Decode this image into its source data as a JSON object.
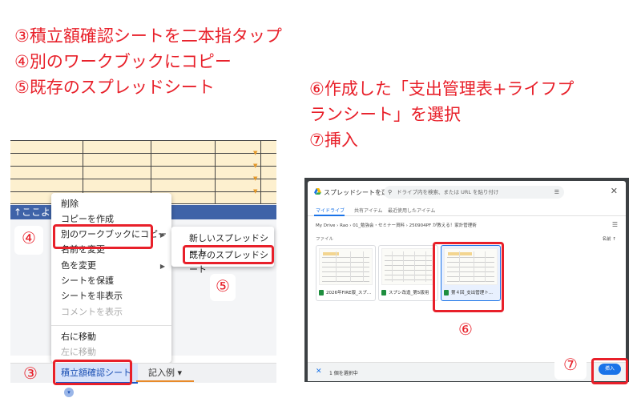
{
  "instructions": {
    "step3": "③積立額確認シートを二本指タップ",
    "step4": "④別のワークブックにコピー",
    "step5": "⑤既存のスプレッドシート",
    "step6_line1": "⑥作成した「支出管理表+ライフプ",
    "step6_line2": "ランシート」を選択",
    "step7": "⑦挿入"
  },
  "callouts": {
    "n3": "③",
    "n4": "④",
    "n5": "⑤",
    "n6": "⑥",
    "n7": "⑦"
  },
  "sheet": {
    "banner_text": "↑ここより上"
  },
  "context_menu": {
    "items": [
      {
        "label": "削除"
      },
      {
        "label": "コピーを作成"
      },
      {
        "label": "別のワークブックにコピー"
      },
      {
        "label": "名前を変更"
      },
      {
        "label": "色を変更"
      },
      {
        "label": "シートを保護"
      },
      {
        "label": "シートを非表示"
      },
      {
        "label": "コメントを表示"
      },
      {
        "label": "右に移動"
      },
      {
        "label": "左に移動"
      }
    ],
    "submenu_caret": "▶",
    "color_caret": "▶"
  },
  "submenu": {
    "items": [
      {
        "label": "新しいスプレッドシート"
      },
      {
        "label": "既存のスプレッドシート"
      }
    ]
  },
  "sheet_tabs": {
    "active_tab": "積立額確認シート",
    "other_tab": "記入例",
    "dropdown_glyph": "▾"
  },
  "picker": {
    "title": "スプレッドシートを選択",
    "search_placeholder": "ドライブ内を検索、または URL を貼り付け",
    "tabs": [
      "マイドライブ",
      "共有アイテム",
      "最近使用したアイテム"
    ],
    "breadcrumb": "My Drive  ›  Rao  ›  01_勉強会・セミナー資料  ›  250904PF が教える！家計管理術",
    "section_label": "ファイル",
    "sort_label": "名前  ↑",
    "files": [
      {
        "name": "2026年FIRE版_スプ..."
      },
      {
        "name": "スプシ改造_第5版用"
      },
      {
        "name": "第４回_支出管理ト..."
      }
    ],
    "selected_count": "1 個を選択中",
    "insert_label": "挿入"
  }
}
